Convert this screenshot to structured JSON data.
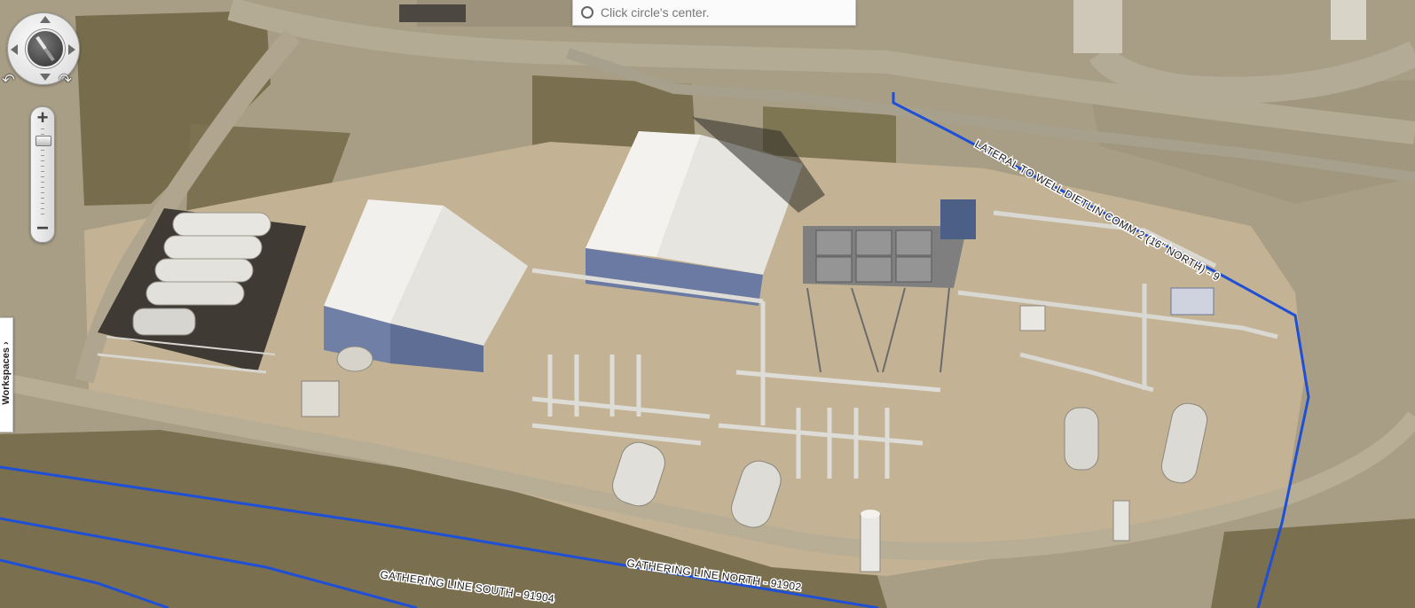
{
  "map": {
    "imagery": "oblique aerial imagery of a gas processing facility",
    "colors": {
      "ground": "#a89e86",
      "grass": "#7c7251",
      "gravel": "#c3b394",
      "road": "#b1a892",
      "pipeline": "#1f4fd6",
      "roof": "#efeeea",
      "wall": "#6f7fa6"
    },
    "labels": {
      "lateral": "LATERAL TO WELL DIETLIN COMM 2 (16\" NORTH) - 9",
      "gathering_north": "GATHERING LINE NORTH - 91902",
      "gathering_south": "GATHERING LINE SOUTH - 91904"
    }
  },
  "hint": {
    "text": "Click circle's center.",
    "icon": "radio-circle-icon"
  },
  "compass": {
    "icon": "compass-icon",
    "rotate_left_icon": "rotate-ccw-icon",
    "rotate_right_icon": "rotate-cw-icon"
  },
  "zoom": {
    "plus": "+",
    "minus": "−",
    "level_fraction": 0.25
  },
  "workspaces": {
    "label": "Workspaces",
    "chevron": "›",
    "icon": "chevron-down-icon"
  }
}
